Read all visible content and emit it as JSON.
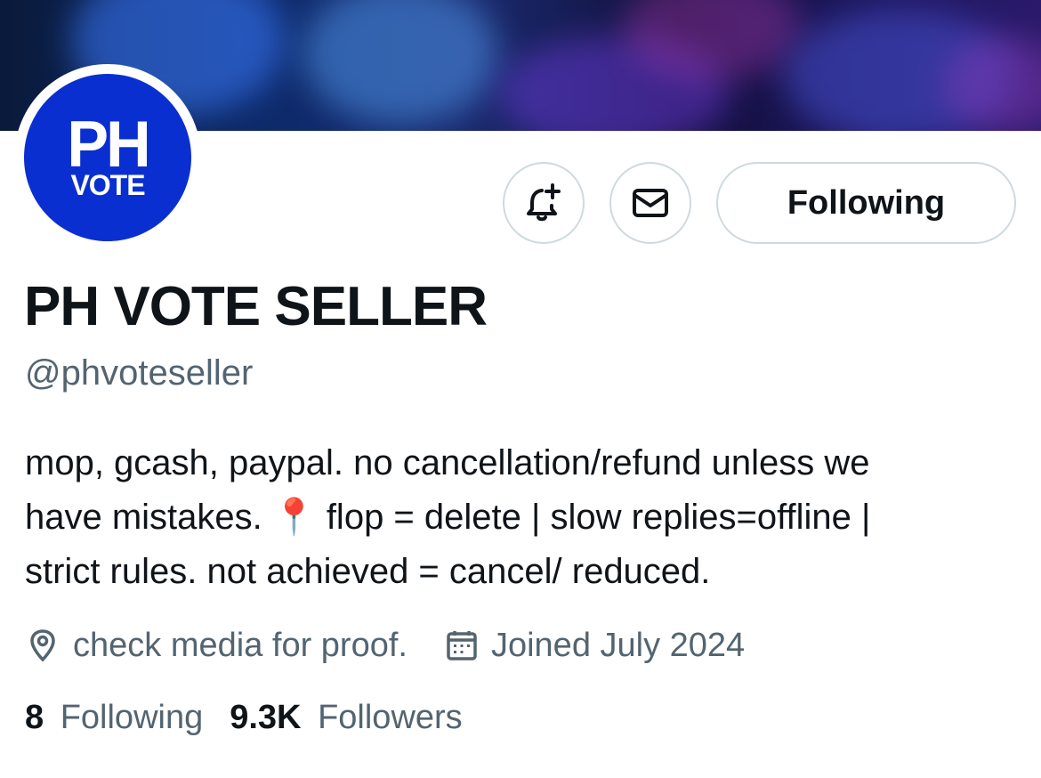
{
  "profile": {
    "avatar_line1": "PH",
    "avatar_line2": "VOTE",
    "display_name": "PH VOTE SELLER",
    "handle": "@phvoteseller",
    "bio_line1": "mop, gcash, paypal. no cancellation/refund unless we",
    "bio_line2_a": "have mistakes. ",
    "bio_pin_emoji": "📍",
    "bio_line2_b": " flop = delete | slow replies=offline |",
    "bio_line3": "strict rules. not achieved = cancel/ reduced.",
    "location": "check media for proof.",
    "joined": "Joined July 2024"
  },
  "actions": {
    "notify_icon": "bell-plus-icon",
    "message_icon": "envelope-icon",
    "follow_label": "Following"
  },
  "stats": {
    "following_count": "8",
    "following_label": "Following",
    "followers_count": "9.3K",
    "followers_label": "Followers"
  },
  "colors": {
    "avatar_bg": "#0a2fd1",
    "text_primary": "#0f1419",
    "text_secondary": "#536471",
    "border": "#cfd9de"
  }
}
